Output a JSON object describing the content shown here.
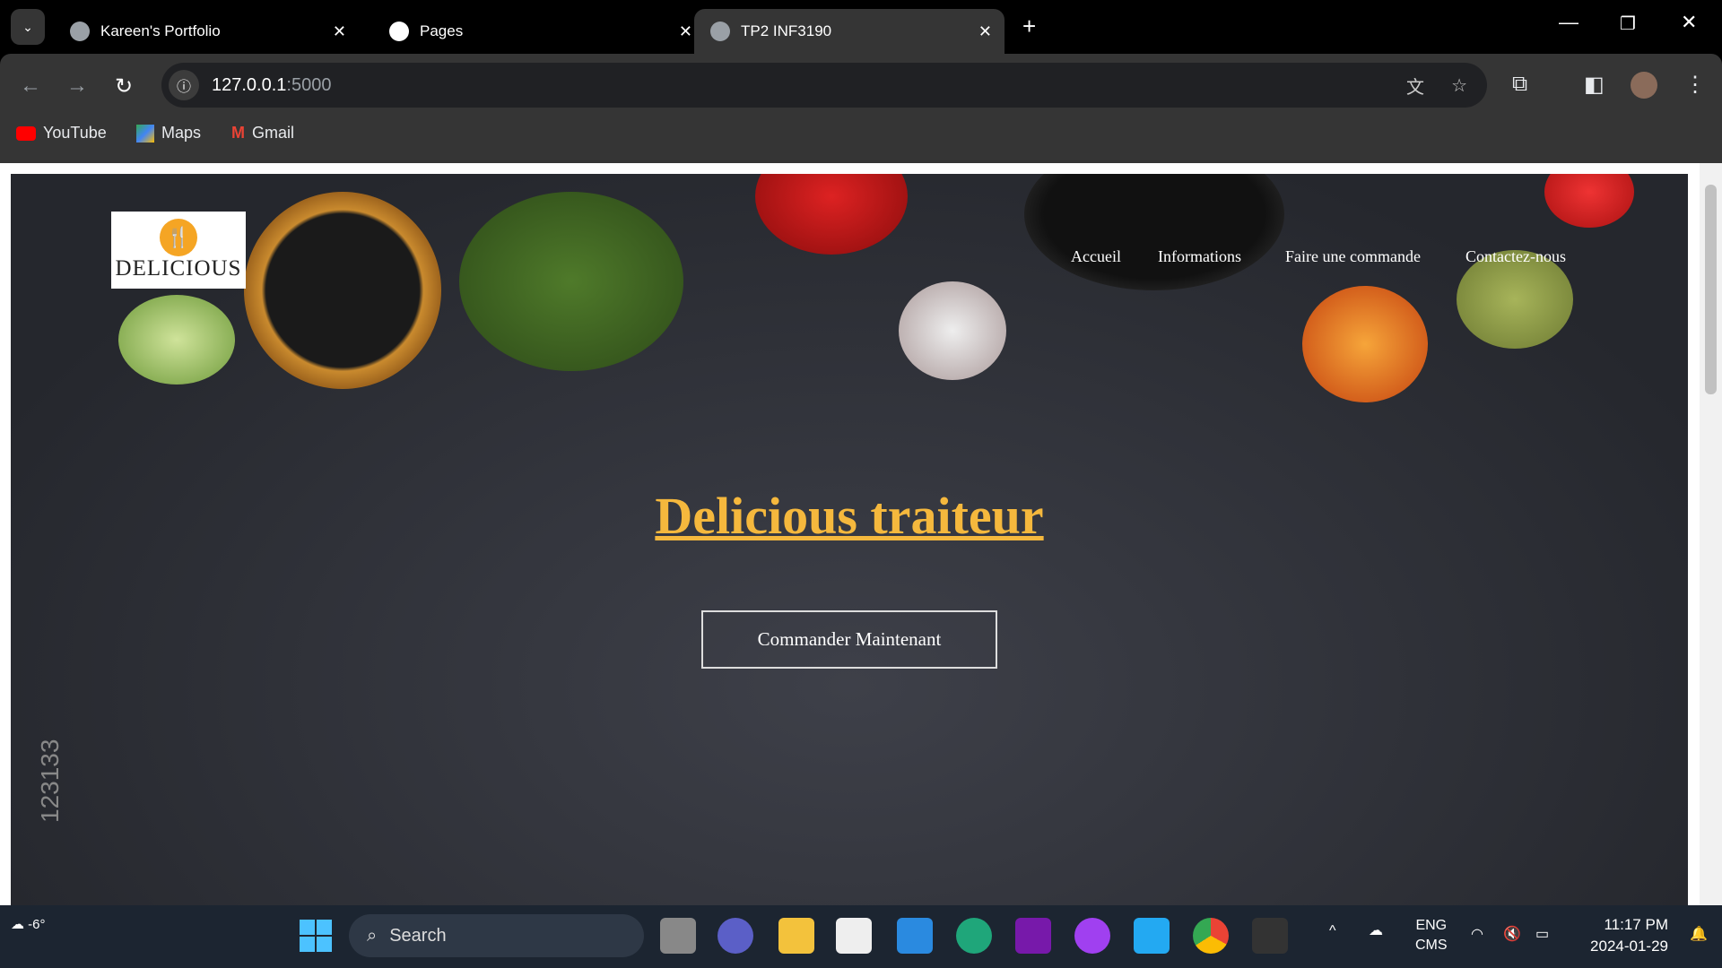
{
  "browser": {
    "tabs": [
      {
        "title": "Kareen's Portfolio",
        "active": false
      },
      {
        "title": "Pages",
        "active": false
      },
      {
        "title": "TP2 INF3190",
        "active": true
      }
    ],
    "url_host": "127.0.0.1",
    "url_port": ":5000",
    "bookmarks": [
      "YouTube",
      "Maps",
      "Gmail"
    ]
  },
  "site": {
    "logo_text": "DELICIOUS",
    "nav": [
      "Accueil",
      "Informations",
      "Faire une commande",
      "Contactez-nous"
    ],
    "title": "Delicious traiteur",
    "cta": "Commander Maintenant",
    "watermark": "123133",
    "accent": "#f5b83d"
  },
  "taskbar": {
    "weather": "-6°",
    "search": "Search",
    "lang": "ENG",
    "ime": "CMS",
    "time": "11:17 PM",
    "date": "2024-01-29"
  }
}
